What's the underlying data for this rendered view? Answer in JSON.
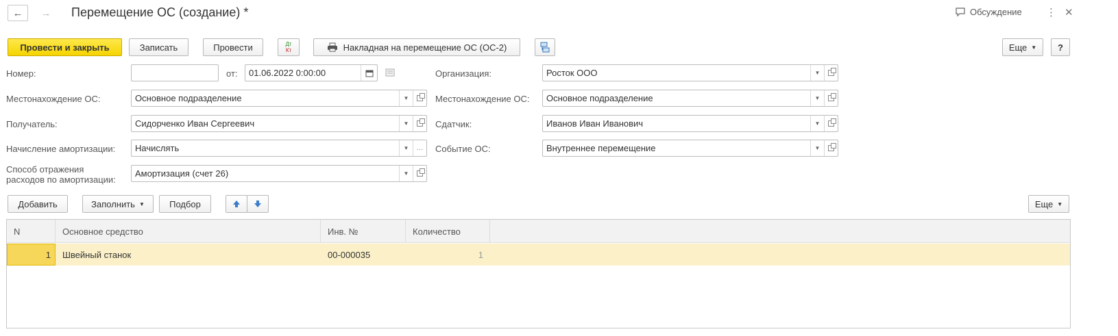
{
  "header": {
    "back_icon": "arrow-left-icon",
    "forward_icon": "arrow-right-icon",
    "title": "Перемещение ОС (создание) *",
    "discussion_label": "Обсуждение",
    "more_icon": "⋮",
    "close_icon": "✕"
  },
  "toolbar": {
    "post_close_label": "Провести и закрыть",
    "save_label": "Записать",
    "post_label": "Провести",
    "dt_label": "Дт",
    "kt_label": "Кт",
    "waybill_label": "Накладная на перемещение ОС (ОС-2)",
    "more_label": "Еще",
    "help_label": "?"
  },
  "form": {
    "number_label": "Номер:",
    "number_value": "",
    "date_from_label": "от:",
    "date_value": "01.06.2022  0:00:00",
    "org_label": "Организация:",
    "org_value": "Росток ООО",
    "location_label": "Местонахождение ОС:",
    "location_value": "Основное подразделение",
    "location2_label": "Местонахождение ОС:",
    "location2_value": "Основное подразделение",
    "recipient_label": "Получатель:",
    "recipient_value": "Сидорченко Иван Сергеевич",
    "sender_label": "Сдатчик:",
    "sender_value": "Иванов Иван Иванович",
    "amort_label": "Начисление амортизации:",
    "amort_value": "Начислять",
    "event_label": "Событие ОС:",
    "event_value": "Внутреннее перемещение",
    "method_label_line1": "Способ отражения",
    "method_label_line2": "расходов по амортизации:",
    "method_value": "Амортизация (счет 26)"
  },
  "table_toolbar": {
    "add_label": "Добавить",
    "fill_label": "Заполнить",
    "pick_label": "Подбор",
    "more_label": "Еще"
  },
  "table": {
    "columns": [
      "N",
      "Основное средство",
      "Инв. №",
      "Количество"
    ],
    "rows": [
      {
        "n": "1",
        "asset": "Швейный станок",
        "inv": "00-000035",
        "qty": "1"
      }
    ]
  },
  "colors": {
    "primary_button": "#f5d400",
    "selected_row": "#fbf0c8"
  }
}
